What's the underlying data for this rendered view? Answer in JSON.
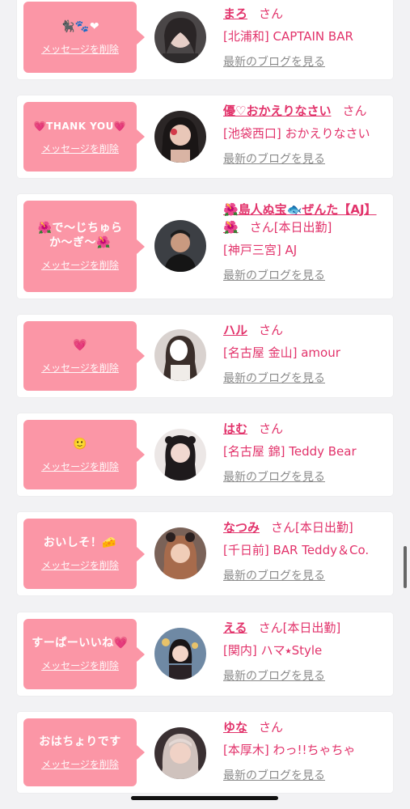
{
  "colors": {
    "accent": "#e2336b",
    "bubble": "#fb96a6",
    "link": "#8a8a8a"
  },
  "labels": {
    "delete": "メッセージを削除",
    "blog": "最新のブログを見る",
    "san": "さん"
  },
  "entries": [
    {
      "message": "🐈‍⬛🐾❤",
      "name": "まろ",
      "status": "",
      "shop": "[北浦和] CAPTAIN BAR",
      "avatar_icon": "person-photo"
    },
    {
      "message": "💗THANK YOU💗",
      "name": "優♡おかえりなさい",
      "status": "",
      "shop": "[池袋西口] おかえりなさい",
      "avatar_icon": "person-photo"
    },
    {
      "message": "🌺で〜じちゅらか〜ぎ〜🌺",
      "name": "🌺島人ぬ宝🐟ぜんた【AJ】🌺",
      "status": "[本日出勤]",
      "shop": "[神戸三宮] AJ",
      "avatar_icon": "person-photo"
    },
    {
      "message": "💗",
      "name": "ハル",
      "status": "",
      "shop": "[名古屋 金山] amour",
      "avatar_icon": "person-photo"
    },
    {
      "message": "🙂",
      "name": "はむ",
      "status": "",
      "shop": "[名古屋 錦] Teddy Bear",
      "avatar_icon": "person-photo"
    },
    {
      "message": "おいしそ！🧀",
      "name": "なつみ",
      "status": "[本日出勤]",
      "shop": "[千日前] BAR Teddy＆Co.",
      "avatar_icon": "person-photo"
    },
    {
      "message": "すーぱーいいね💗",
      "name": "える",
      "status": "[本日出勤]",
      "shop": "[関内] ハマ⭑Style",
      "avatar_icon": "person-photo"
    },
    {
      "message": "おはちょりです",
      "name": "ゆな",
      "status": "",
      "shop": "[本厚木] わっ!!ちゃちゃ",
      "avatar_icon": "person-photo"
    }
  ]
}
